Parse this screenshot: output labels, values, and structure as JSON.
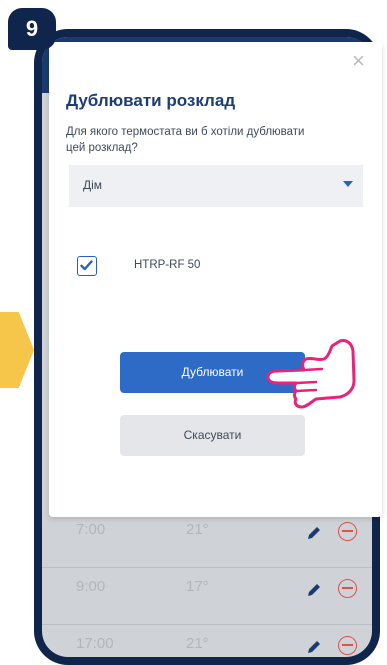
{
  "step": "9",
  "dialog": {
    "title": "Дублювати розклад",
    "question": "Для якого термостата ви б хотіли дублювати цей розклад?",
    "select_value": "Дім",
    "checkbox_label": "HTRP-RF 50",
    "checkbox_checked": true,
    "primary_button": "Дублювати",
    "secondary_button": "Скасувати",
    "close_symbol": "×"
  },
  "schedule": {
    "rows": [
      {
        "time": "7:00",
        "temp": "21°"
      },
      {
        "time": "9:00",
        "temp": "17°"
      },
      {
        "time": "17:00",
        "temp": "21°"
      }
    ]
  },
  "colors": {
    "frame": "#10254b",
    "accent": "#2d6bc6",
    "delete": "#d9534f",
    "hint_arrow": "#f6c64a",
    "pointer": "#e5247a"
  }
}
